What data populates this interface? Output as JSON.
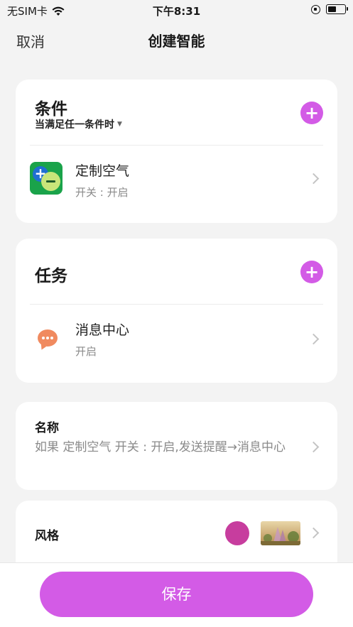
{
  "status_bar": {
    "carrier": "无SIM卡",
    "time": "下午8:31",
    "battery_level": 0.5,
    "icons": [
      "wifi-icon",
      "orientation-lock-icon",
      "battery-icon"
    ]
  },
  "nav": {
    "cancel": "取消",
    "title": "创建智能"
  },
  "condition": {
    "title": "条件",
    "subtitle": "当满足任一条件时",
    "items": [
      {
        "title": "定制空气",
        "subtitle": "开关 : 开启",
        "icon": "custom-air-app-icon"
      }
    ]
  },
  "task": {
    "title": "任务",
    "items": [
      {
        "title": "消息中心",
        "subtitle": "开启",
        "icon": "message-center-icon"
      }
    ]
  },
  "name": {
    "label": "名称",
    "value": "如果 定制空气 开关 : 开启,发送提醒→消息中心"
  },
  "style": {
    "label": "风格",
    "color": "#c73d9e"
  },
  "footer": {
    "save": "保存"
  },
  "colors": {
    "accent": "#d35be6",
    "background": "#f3f3f3"
  }
}
